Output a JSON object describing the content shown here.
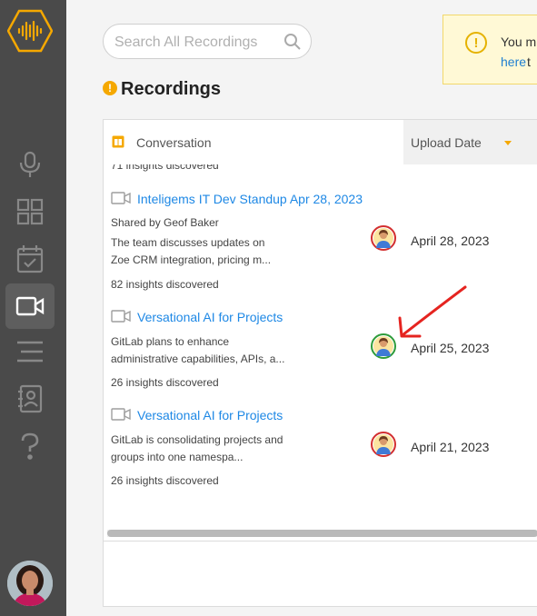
{
  "search": {
    "placeholder": "Search All Recordings"
  },
  "notice": {
    "line1": "You m",
    "link": "here",
    "line2": "t"
  },
  "page": {
    "title": "Recordings"
  },
  "table": {
    "columns": {
      "conversation": "Conversation",
      "upload_date": "Upload Date"
    },
    "cut_top_text": "71 insights discovered",
    "rows": [
      {
        "title": "Inteligems IT Dev Standup Apr 28, 2023",
        "shared": "Shared by Geof Baker",
        "desc1": "The team discusses updates on",
        "desc2": "Zoe CRM integration, pricing m...",
        "insights": "82 insights discovered",
        "date": "April 28, 2023"
      },
      {
        "title": "Versational AI for Projects",
        "desc1": "GitLab plans to enhance",
        "desc2": "administrative capabilities, APIs, a...",
        "insights": "26 insights discovered",
        "date": "April 25, 2023"
      },
      {
        "title": "Versational AI for Projects",
        "desc1": "GitLab is consolidating projects and",
        "desc2": "groups into one namespa...",
        "insights": "26 insights discovered",
        "date": "April 21, 2023"
      }
    ]
  },
  "colors": {
    "sidebar": "#4a4a4a",
    "accent": "#f5a800",
    "link": "#1e88e5",
    "owner_red": "#d32f2f",
    "owner_green": "#2e9c3a",
    "annotation_arrow": "#e52420"
  }
}
